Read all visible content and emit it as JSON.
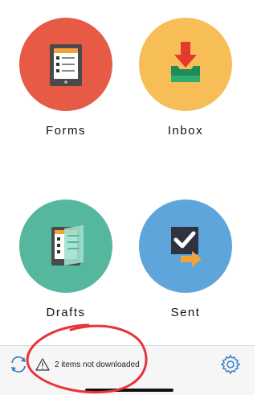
{
  "tiles": {
    "forms": {
      "label": "Forms",
      "color": "#E65A46",
      "icon": "forms-icon"
    },
    "inbox": {
      "label": "Inbox",
      "color": "#F7BE57",
      "icon": "inbox-icon"
    },
    "drafts": {
      "label": "Drafts",
      "color": "#55B79E",
      "icon": "drafts-icon"
    },
    "sent": {
      "label": "Sent",
      "color": "#5DA5DA",
      "icon": "sent-icon"
    }
  },
  "bottom_bar": {
    "sync_icon": "sync-icon",
    "status_text": "2 items not downloaded",
    "warning_icon": "warning-icon",
    "settings_icon": "gear-icon",
    "accent": "#2F7FC6"
  },
  "annotation_color": "#E8343B"
}
